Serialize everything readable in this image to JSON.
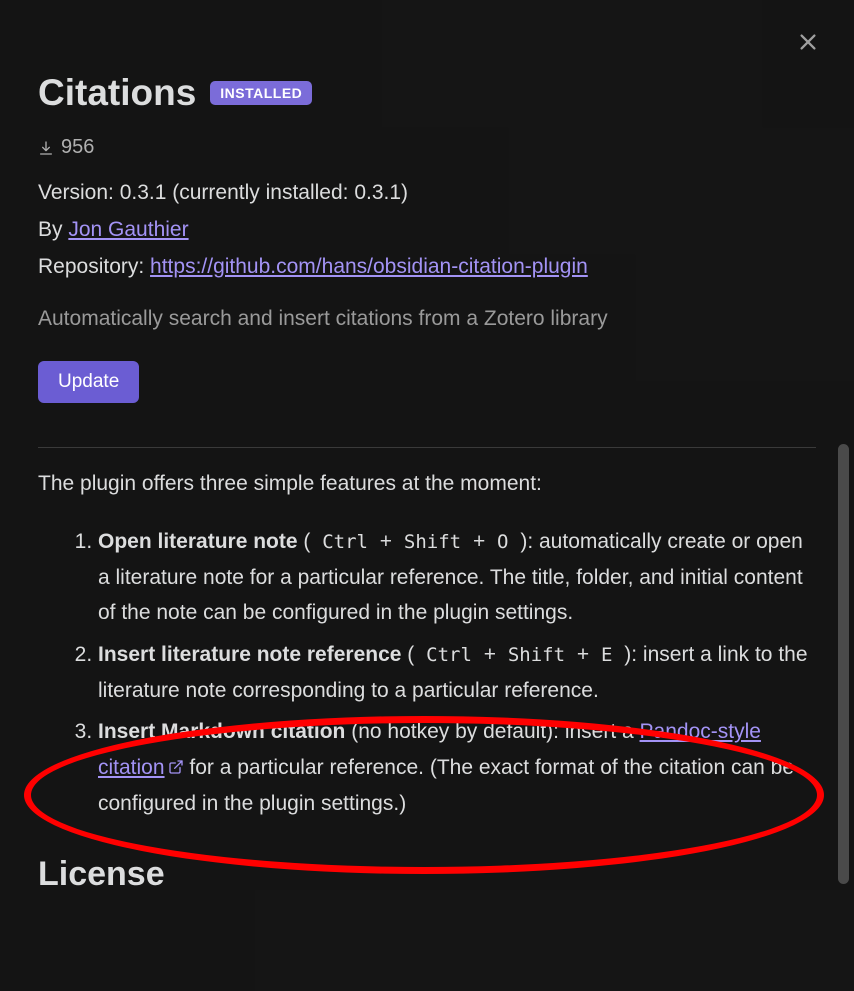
{
  "header": {
    "title": "Citations",
    "badge": "INSTALLED"
  },
  "stats": {
    "downloads": "956"
  },
  "meta": {
    "version_line": "Version: 0.3.1 (currently installed: 0.3.1)",
    "by_label": "By ",
    "author": "Jon Gauthier",
    "repo_label": "Repository: ",
    "repo_url": "https://github.com/hans/obsidian-citation-plugin"
  },
  "description": "Automatically search and insert citations from a Zotero library",
  "actions": {
    "update": "Update"
  },
  "body": {
    "intro": "The plugin offers three simple features at the moment:",
    "features": [
      {
        "name": "Open literature note",
        "hotkey_prefix": " ( ",
        "hotkeys": [
          "Ctrl",
          "Shift",
          "O"
        ],
        "hotkey_suffix": " ): ",
        "text": "automatically create or open a literature note for a particular reference. The title, folder, and initial content of the note can be configured in the plugin settings."
      },
      {
        "name": "Insert literature note reference",
        "hotkey_prefix": " ( ",
        "hotkeys": [
          "Ctrl",
          "Shift",
          "E"
        ],
        "hotkey_suffix": " ): ",
        "text": "insert a link to the literature note corresponding to a particular reference."
      },
      {
        "name": "Insert Markdown citation",
        "nohotkey": " (no hotkey by default): insert a ",
        "link_text": "Pandoc-style citation",
        "text_after": " for a particular reference. (The exact format of the citation can be configured in the plugin settings.)"
      }
    ],
    "license_heading": "License"
  }
}
